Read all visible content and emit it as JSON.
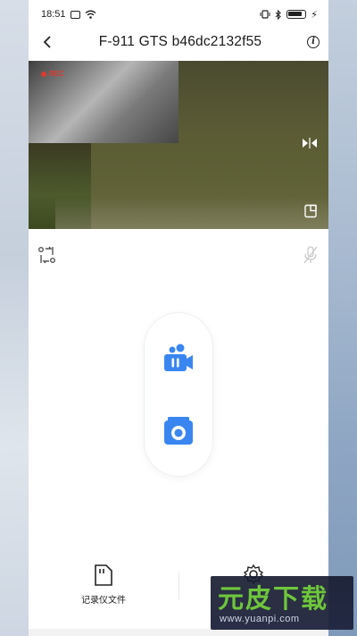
{
  "status_bar": {
    "time": "18:51"
  },
  "nav": {
    "title": "F-911 GTS b46dc2132f55"
  },
  "video": {
    "rec_label": "REC"
  },
  "bottom": {
    "files_label": "记录仪文件"
  },
  "watermark": {
    "title": "元皮下载",
    "url": "www.yuanpi.com"
  },
  "colors": {
    "accent_blue": "#3a86f0",
    "rec_red": "#e03a2f",
    "watermark_green": "#6ec63b"
  },
  "icons": {
    "back": "chevron-left-icon",
    "info": "info-icon",
    "mirror": "mirror-flip-icon",
    "fullscreen": "fullscreen-icon",
    "rotate": "camera-switch-icon",
    "mic": "mic-muted-icon",
    "video": "video-camera-icon",
    "photo": "camera-icon",
    "files": "sd-card-icon",
    "settings": "gear-icon"
  }
}
